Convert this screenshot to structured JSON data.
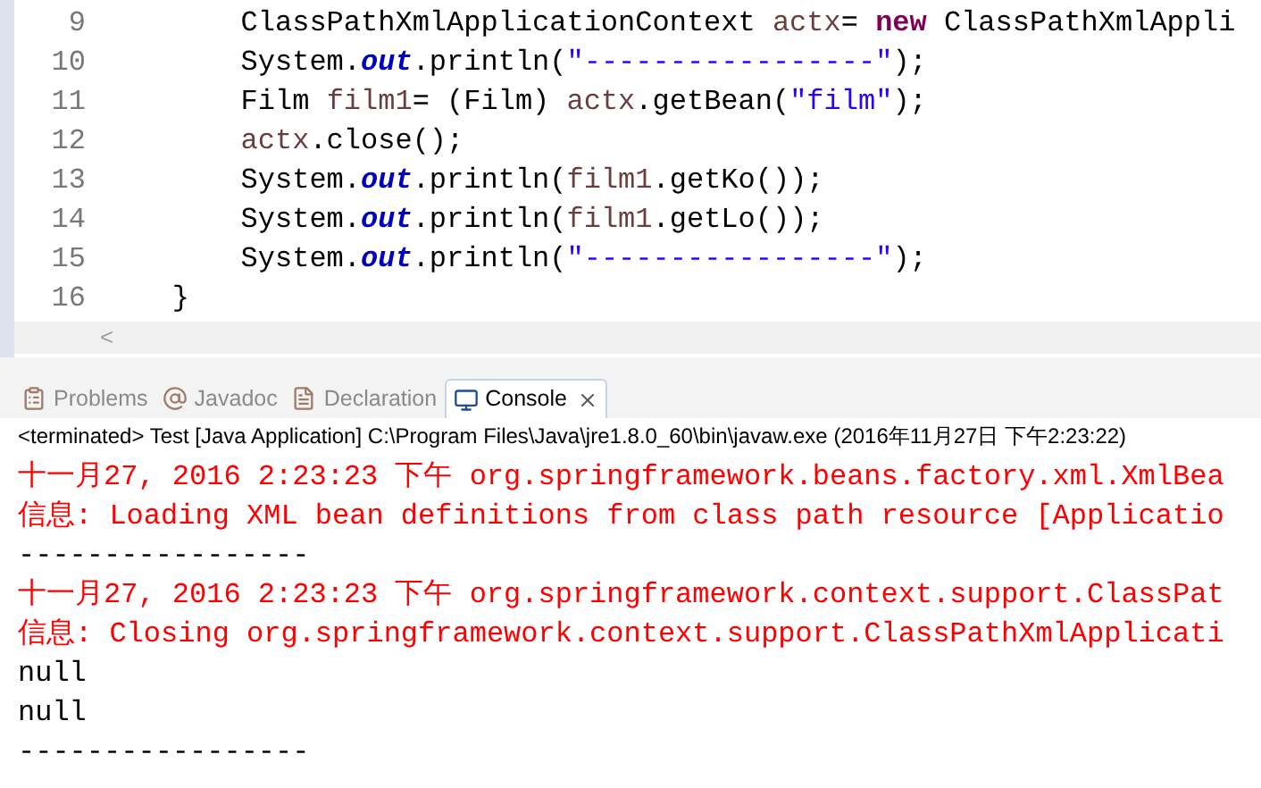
{
  "editor": {
    "lines": [
      {
        "number": "9",
        "kind": "body",
        "tokens": [
          {
            "kind": "plain",
            "text": "ClassPathXmlApplicationContext "
          },
          {
            "kind": "local",
            "text": "actx"
          },
          {
            "kind": "plain",
            "text": "= "
          },
          {
            "kind": "keyword",
            "text": "new"
          },
          {
            "kind": "plain",
            "text": " ClassPathXmlAppli"
          }
        ]
      },
      {
        "number": "10",
        "kind": "body",
        "tokens": [
          {
            "kind": "plain",
            "text": "System."
          },
          {
            "kind": "field",
            "text": "out"
          },
          {
            "kind": "plain",
            "text": ".println("
          },
          {
            "kind": "string",
            "text": "\"-----------------\""
          },
          {
            "kind": "plain",
            "text": ");"
          }
        ]
      },
      {
        "number": "11",
        "kind": "body",
        "tokens": [
          {
            "kind": "plain",
            "text": "Film "
          },
          {
            "kind": "local",
            "text": "film1"
          },
          {
            "kind": "plain",
            "text": "= (Film) "
          },
          {
            "kind": "local",
            "text": "actx"
          },
          {
            "kind": "plain",
            "text": ".getBean("
          },
          {
            "kind": "string",
            "text": "\"film\""
          },
          {
            "kind": "plain",
            "text": ");"
          }
        ]
      },
      {
        "number": "12",
        "kind": "body",
        "tokens": [
          {
            "kind": "local",
            "text": "actx"
          },
          {
            "kind": "plain",
            "text": ".close();"
          }
        ]
      },
      {
        "number": "13",
        "kind": "body",
        "tokens": [
          {
            "kind": "plain",
            "text": "System."
          },
          {
            "kind": "field",
            "text": "out"
          },
          {
            "kind": "plain",
            "text": ".println("
          },
          {
            "kind": "local",
            "text": "film1"
          },
          {
            "kind": "plain",
            "text": ".getKo());"
          }
        ]
      },
      {
        "number": "14",
        "kind": "body",
        "tokens": [
          {
            "kind": "plain",
            "text": "System."
          },
          {
            "kind": "field",
            "text": "out"
          },
          {
            "kind": "plain",
            "text": ".println("
          },
          {
            "kind": "local",
            "text": "film1"
          },
          {
            "kind": "plain",
            "text": ".getLo());"
          }
        ]
      },
      {
        "number": "15",
        "kind": "body",
        "tokens": [
          {
            "kind": "plain",
            "text": "System."
          },
          {
            "kind": "field",
            "text": "out"
          },
          {
            "kind": "plain",
            "text": ".println("
          },
          {
            "kind": "string",
            "text": "\"-----------------\""
          },
          {
            "kind": "plain",
            "text": ");"
          }
        ]
      },
      {
        "number": "16",
        "kind": "close",
        "tokens": [
          {
            "kind": "plain",
            "text": "}"
          }
        ]
      }
    ],
    "scroll_left": "<"
  },
  "tabs": [
    {
      "label": "Problems",
      "kind": "problems",
      "selected": false
    },
    {
      "label": "Javadoc",
      "kind": "javadoc",
      "selected": false
    },
    {
      "label": "Declaration",
      "kind": "declaration",
      "selected": false
    },
    {
      "label": "Console",
      "kind": "console",
      "selected": true
    }
  ],
  "console": {
    "status": "<terminated> Test [Java Application] C:\\Program Files\\Java\\jre1.8.0_60\\bin\\javaw.exe (2016年11月27日 下午2:23:22)",
    "lines": [
      {
        "kind": "err",
        "text": "十一月27, 2016 2:23:23 下午 org.springframework.beans.factory.xml.XmlBea"
      },
      {
        "kind": "err",
        "text": "信息: Loading XML bean definitions from class path resource [Applicatio"
      },
      {
        "kind": "out",
        "text": "-----------------"
      },
      {
        "kind": "err",
        "text": "十一月27, 2016 2:23:23 下午 org.springframework.context.support.ClassPat"
      },
      {
        "kind": "err",
        "text": "信息: Closing org.springframework.context.support.ClassPathXmlApplicati"
      },
      {
        "kind": "out",
        "text": "null"
      },
      {
        "kind": "out",
        "text": "null"
      },
      {
        "kind": "out",
        "text": "-----------------"
      }
    ]
  }
}
